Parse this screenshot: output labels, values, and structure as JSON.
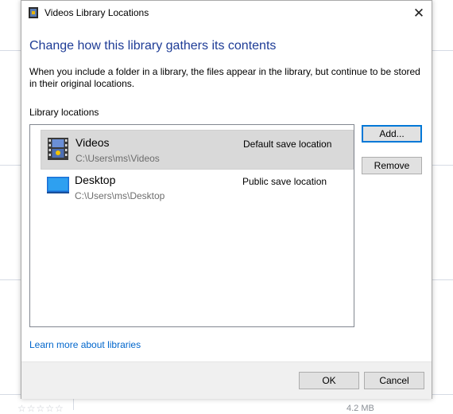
{
  "dialog": {
    "title": "Videos Library Locations",
    "close_label": "✕",
    "heading": "Change how this library gathers its contents",
    "description": "When you include a folder in a library, the files appear in the library, but continue to be stored in their original locations.",
    "locations_label": "Library locations",
    "locations": [
      {
        "name": "Videos",
        "path": "C:\\Users\\ms\\Videos",
        "status": "Default save location",
        "icon": "videos-folder-icon",
        "selected": true
      },
      {
        "name": "Desktop",
        "path": "C:\\Users\\ms\\Desktop",
        "status": "Public save location",
        "icon": "desktop-folder-icon",
        "selected": false
      }
    ],
    "add_label": "Add...",
    "remove_label": "Remove",
    "learn_more": "Learn more about libraries",
    "ok_label": "OK",
    "cancel_label": "Cancel"
  },
  "background": {
    "stars": "☆☆☆☆☆",
    "size_text": "4.2 MB"
  },
  "colors": {
    "heading": "#1e3c96",
    "link": "#0066cc",
    "selection": "#d9d9d9",
    "default_button_border": "#0078d7"
  }
}
